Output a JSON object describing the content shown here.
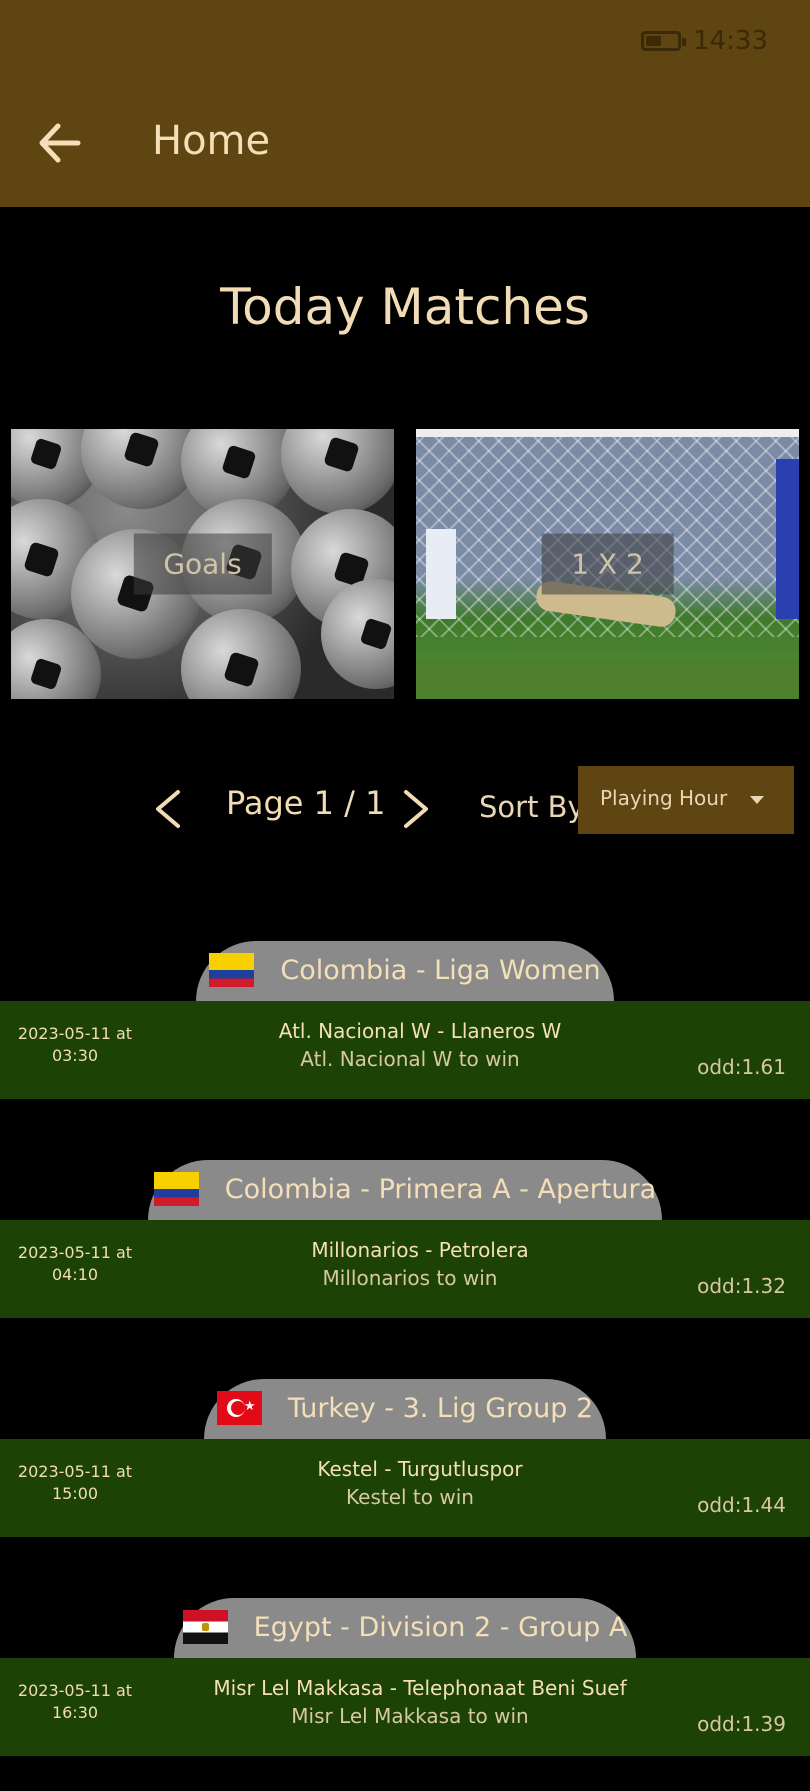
{
  "status_bar": {
    "time": "14:33"
  },
  "appbar": {
    "title": "Home"
  },
  "heading": "Today Matches",
  "tiles": [
    {
      "label": "Goals"
    },
    {
      "label": "1 X 2"
    }
  ],
  "pager": {
    "page_text": "Page 1 / 1"
  },
  "sort": {
    "label": "Sort By:",
    "value": "Playing Hour"
  },
  "matches": [
    {
      "league": "Colombia - Liga Women",
      "flag": "colombia-flag",
      "date": "2023-05-11 at",
      "time": "03:30",
      "teams": "Atl. Nacional W - Llaneros W",
      "pick": "Atl. Nacional W to win",
      "odd": "odd:1.61"
    },
    {
      "league": "Colombia - Primera A - Apertura",
      "flag": "colombia-flag",
      "date": "2023-05-11 at",
      "time": "04:10",
      "teams": "Millonarios - Petrolera",
      "pick": "Millonarios to win",
      "odd": "odd:1.32"
    },
    {
      "league": "Turkey - 3. Lig Group 2",
      "flag": "turkey-flag",
      "date": "2023-05-11 at",
      "time": "15:00",
      "teams": "Kestel - Turgutluspor",
      "pick": "Kestel to win",
      "odd": "odd:1.44"
    },
    {
      "league": "Egypt - Division 2 - Group A",
      "flag": "egypt-flag",
      "date": "2023-05-11 at",
      "time": "16:30",
      "teams": "Misr Lel Makkasa - Telephonaat Beni Suef",
      "pick": "Misr Lel Makkasa to win",
      "odd": "odd:1.39"
    }
  ],
  "colors": {
    "appbar": "#5e4511",
    "match_row": "#1c4305",
    "league_tab": "#8a8a8a",
    "text": "#f2dcb6"
  }
}
